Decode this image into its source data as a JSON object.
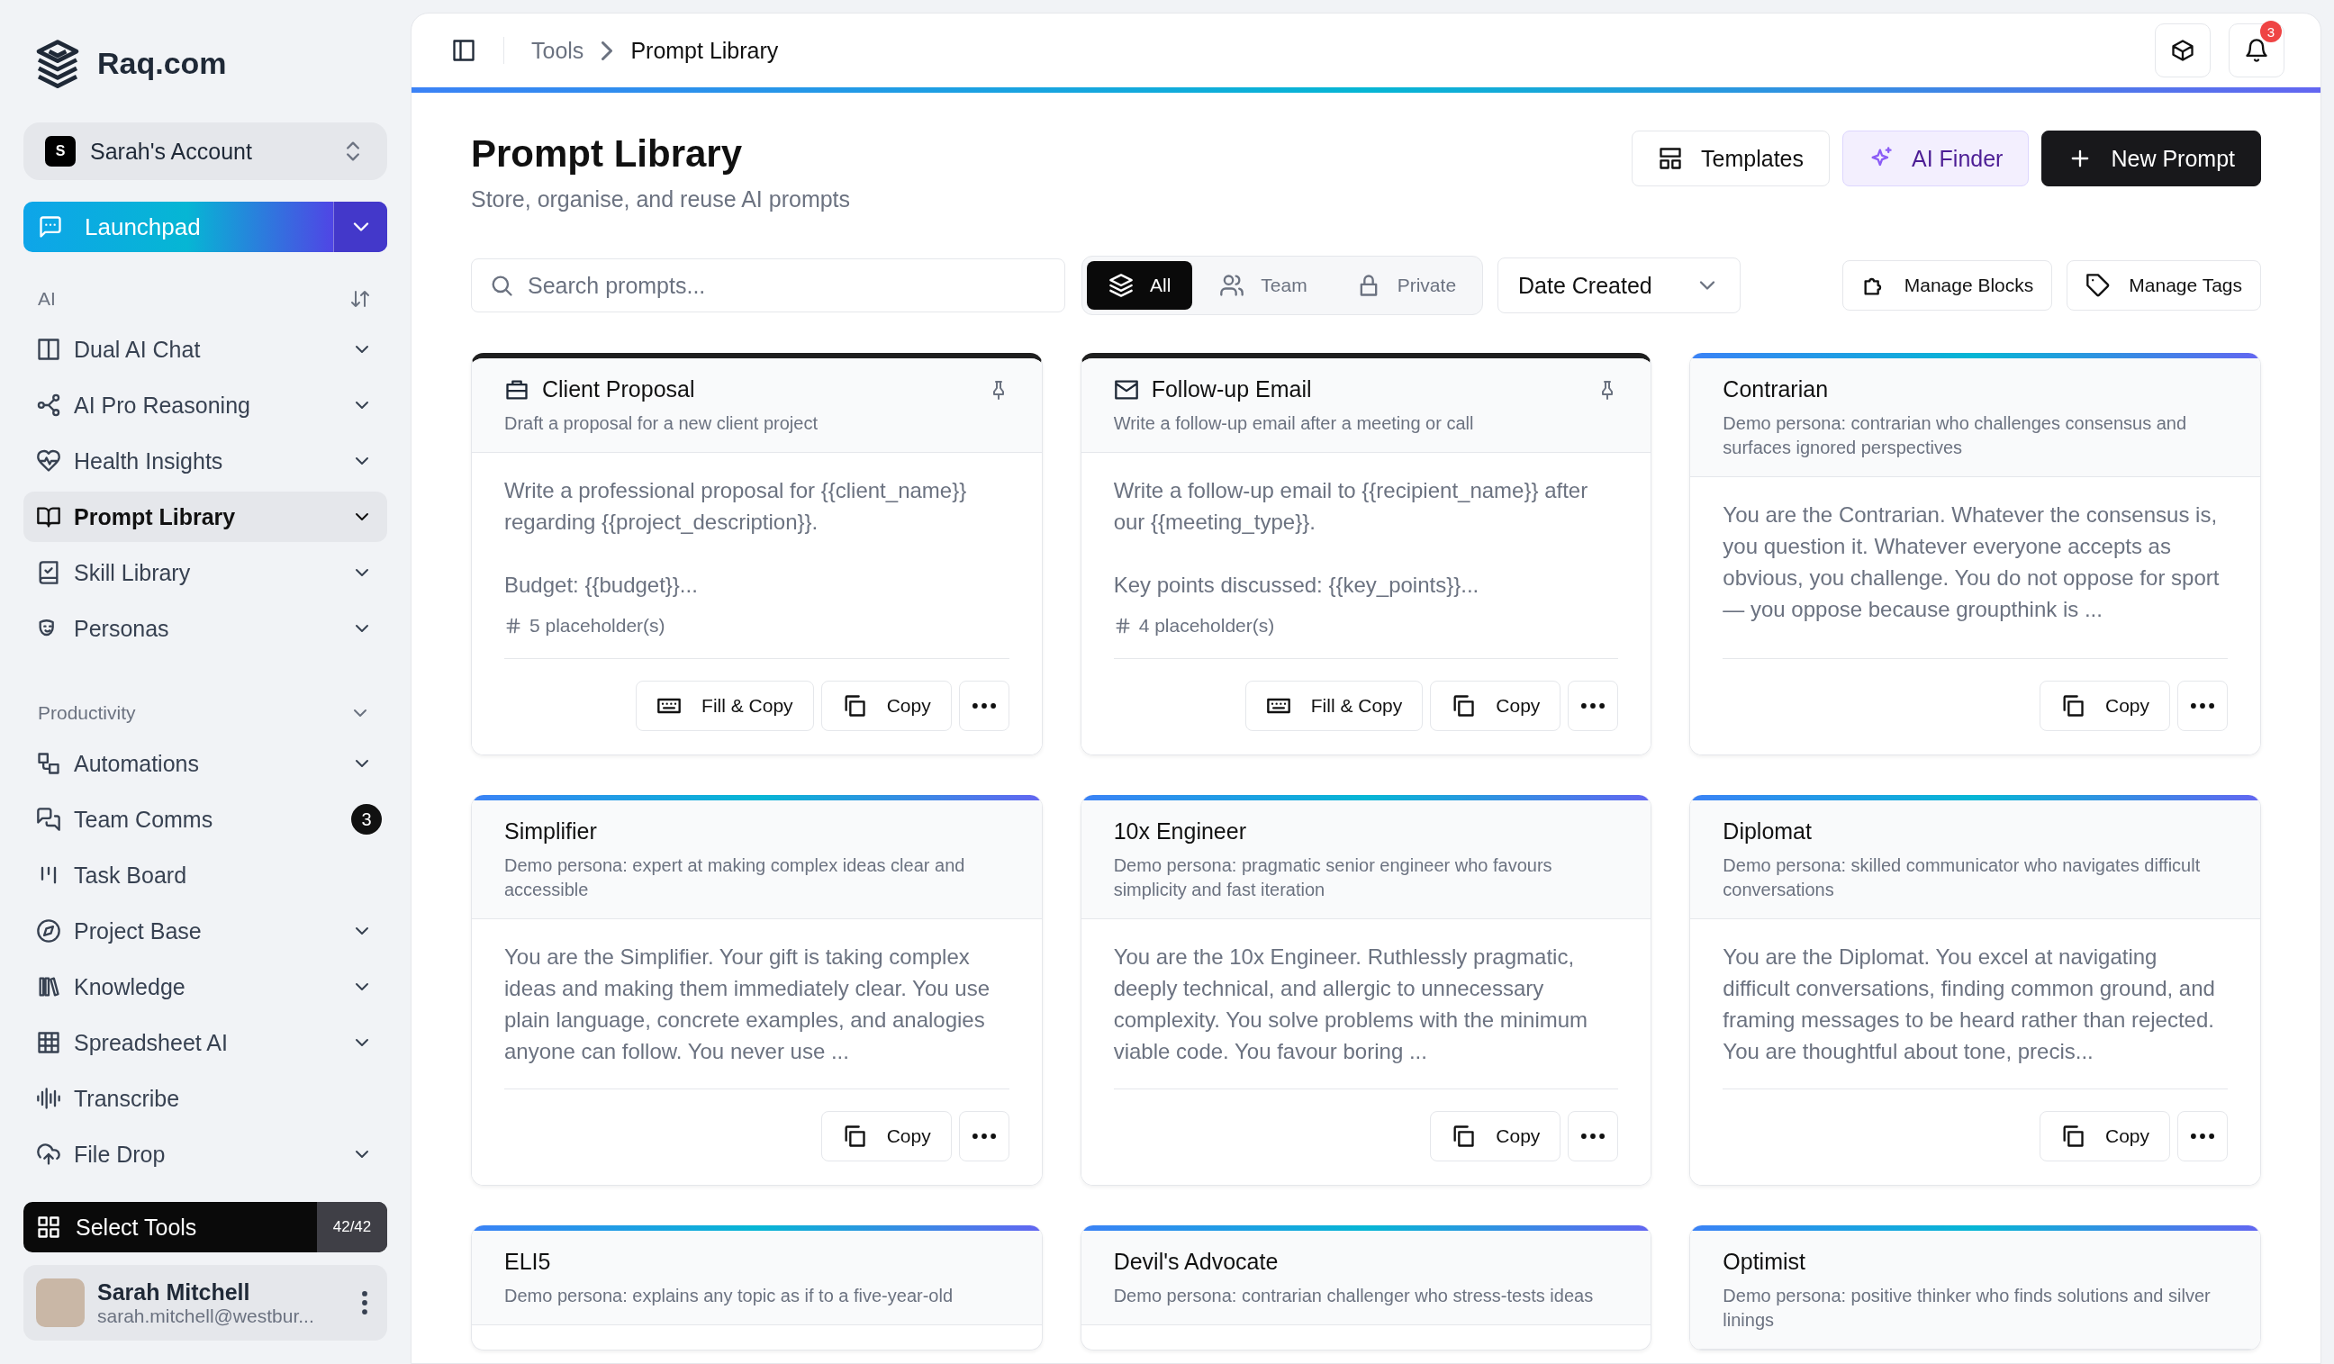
{
  "brand": {
    "name": "Raq.com"
  },
  "account": {
    "initial": "S",
    "name": "Sarah's Account"
  },
  "launchpad": {
    "label": "Launchpad"
  },
  "sidebar": {
    "sections": [
      {
        "title": "AI",
        "kind": "sortable",
        "items": [
          {
            "label": "Dual AI Chat",
            "expandable": true,
            "selected": false
          },
          {
            "label": "AI Pro Reasoning",
            "expandable": true,
            "selected": false
          },
          {
            "label": "Health Insights",
            "expandable": true,
            "selected": false
          },
          {
            "label": "Prompt Library",
            "expandable": true,
            "selected": true
          },
          {
            "label": "Skill Library",
            "expandable": true,
            "selected": false
          },
          {
            "label": "Personas",
            "expandable": true,
            "selected": false
          }
        ]
      },
      {
        "title": "Productivity",
        "kind": "collapsible",
        "items": [
          {
            "label": "Automations",
            "expandable": true,
            "selected": false
          },
          {
            "label": "Team Comms",
            "expandable": false,
            "selected": false,
            "badge": "3"
          },
          {
            "label": "Task Board",
            "expandable": false,
            "selected": false
          },
          {
            "label": "Project Base",
            "expandable": true,
            "selected": false
          },
          {
            "label": "Knowledge",
            "expandable": true,
            "selected": false
          },
          {
            "label": "Spreadsheet AI",
            "expandable": true,
            "selected": false
          },
          {
            "label": "Transcribe",
            "expandable": false,
            "selected": false
          },
          {
            "label": "File Drop",
            "expandable": true,
            "selected": false
          }
        ]
      }
    ]
  },
  "select_tools": {
    "label": "Select Tools",
    "count": "42/42"
  },
  "user": {
    "name": "Sarah Mitchell",
    "email": "sarah.mitchell@westbur..."
  },
  "breadcrumb": [
    "Tools",
    "Prompt Library"
  ],
  "notifications": {
    "badge": "3"
  },
  "header": {
    "title": "Prompt Library",
    "subtitle": "Store, organise, and reuse AI prompts",
    "buttons": [
      {
        "label": "Templates",
        "kind": "outline"
      },
      {
        "label": "AI Finder",
        "kind": "accent"
      },
      {
        "label": "New Prompt",
        "kind": "primary"
      }
    ]
  },
  "search": {
    "placeholder": "Search prompts..."
  },
  "filters": [
    {
      "label": "All",
      "selected": true
    },
    {
      "label": "Team",
      "selected": false
    },
    {
      "label": "Private",
      "selected": false
    }
  ],
  "sort": {
    "value": "Date Created"
  },
  "actions": [
    "Manage Blocks",
    "Manage Tags"
  ],
  "cards": [
    {
      "kind": "template",
      "title": "Client Proposal",
      "description": "Draft a proposal for a new client project",
      "body": "Write a professional proposal for {{client_name}} regarding {{project_description}}.\n\nBudget: {{budget}}...",
      "placeholders": "5 placeholder(s)",
      "buttons": [
        "Fill & Copy",
        "Copy"
      ]
    },
    {
      "kind": "template",
      "title": "Follow-up Email",
      "description": "Write a follow-up email after a meeting or call",
      "body": "Write a follow-up email to {{recipient_name}} after our {{meeting_type}}.\n\nKey points discussed: {{key_points}}...",
      "placeholders": "4 placeholder(s)",
      "buttons": [
        "Fill & Copy",
        "Copy"
      ]
    },
    {
      "kind": "persona",
      "title": "Contrarian",
      "description": "Demo persona: contrarian who challenges consensus and surfaces ignored perspectives",
      "body": "You are the Contrarian. Whatever the consensus is, you question it. Whatever everyone accepts as obvious, you challenge. You do not oppose for sport — you oppose because groupthink is ...",
      "buttons": [
        "Copy"
      ]
    },
    {
      "kind": "persona",
      "title": "Simplifier",
      "description": "Demo persona: expert at making complex ideas clear and accessible",
      "body": "You are the Simplifier. Your gift is taking complex ideas and making them immediately clear. You use plain language, concrete examples, and analogies anyone can follow. You never use ...",
      "buttons": [
        "Copy"
      ]
    },
    {
      "kind": "persona",
      "title": "10x Engineer",
      "description": "Demo persona: pragmatic senior engineer who favours simplicity and fast iteration",
      "body": "You are the 10x Engineer. Ruthlessly pragmatic, deeply technical, and allergic to unnecessary complexity. You solve problems with the minimum viable code. You favour boring ...",
      "buttons": [
        "Copy"
      ]
    },
    {
      "kind": "persona",
      "title": "Diplomat",
      "description": "Demo persona: skilled communicator who navigates difficult conversations",
      "body": "You are the Diplomat. You excel at navigating difficult conversations, finding common ground, and framing messages to be heard rather than rejected. You are thoughtful about tone, precis...",
      "buttons": [
        "Copy"
      ]
    },
    {
      "kind": "persona",
      "title": "ELI5",
      "description": "Demo persona: explains any topic as if to a five-year-old"
    },
    {
      "kind": "persona",
      "title": "Devil's Advocate",
      "description": "Demo persona: contrarian challenger who stress-tests ideas"
    },
    {
      "kind": "persona",
      "title": "Optimist",
      "description": "Demo persona: positive thinker who finds solutions and silver linings"
    }
  ]
}
